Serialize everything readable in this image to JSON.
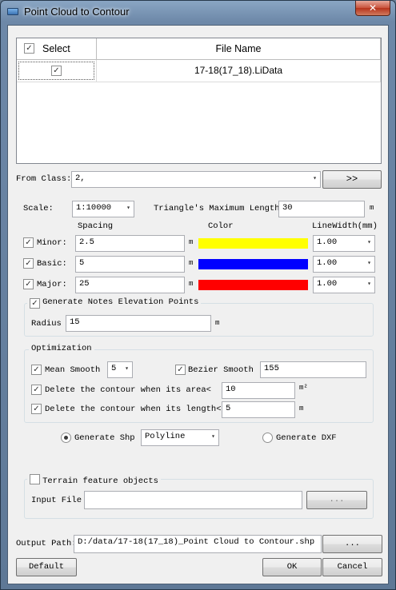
{
  "window": {
    "title": "Point Cloud to Contour",
    "close_glyph": "✕"
  },
  "file_table": {
    "columns": [
      "Select",
      "File Name"
    ],
    "rows": [
      {
        "selected": true,
        "file_name": "17-18(17_18).LiData"
      }
    ]
  },
  "from_class": {
    "label": "From Class:",
    "value": "2,",
    "button_label": ">>"
  },
  "scale": {
    "label": "Scale:",
    "value": "1:10000"
  },
  "triangle": {
    "label": "Triangle's Maximum Length",
    "value": "30",
    "unit": "m"
  },
  "contour_headers": {
    "spacing": "Spacing",
    "color": "Color",
    "linewidth": "LineWidth(mm)"
  },
  "contours": [
    {
      "label": "Minor:",
      "checked": true,
      "spacing": "2.5",
      "unit": "m",
      "color": "#ffff00",
      "linewidth": "1.00"
    },
    {
      "label": "Basic:",
      "checked": true,
      "spacing": "5",
      "unit": "m",
      "color": "#0000ff",
      "linewidth": "1.00"
    },
    {
      "label": "Major:",
      "checked": true,
      "spacing": "25",
      "unit": "m",
      "color": "#ff0000",
      "linewidth": "1.00"
    }
  ],
  "notes": {
    "label": "Generate Notes Elevation Points",
    "checked": true,
    "radius_label": "Radius",
    "radius_value": "15",
    "radius_unit": "m"
  },
  "optimization": {
    "title": "Optimization",
    "mean_smooth_label": "Mean Smooth",
    "mean_smooth_checked": true,
    "mean_smooth_value": "5",
    "bezier_label": "Bezier Smooth",
    "bezier_checked": true,
    "bezier_value": "155",
    "area_label": "Delete the contour when its area<",
    "area_checked": true,
    "area_value": "10",
    "area_unit": "m²",
    "length_label": "Delete the contour when its length<",
    "length_checked": true,
    "length_value": "5",
    "length_unit": "m"
  },
  "output_type": {
    "shp_label": "Generate Shp",
    "shp_selected": true,
    "shp_type": "Polyline",
    "dxf_label": "Generate DXF",
    "dxf_selected": false
  },
  "terrain": {
    "label": "Terrain feature objects",
    "checked": false,
    "input_label": "Input File",
    "input_value": "",
    "browse_label": "..."
  },
  "output_path": {
    "label": "Output Path:",
    "value": "D:/data/17-18(17_18)_Point Cloud to Contour.shp",
    "browse_label": "..."
  },
  "buttons": {
    "default": "Default",
    "ok": "OK",
    "cancel": "Cancel"
  },
  "glyphs": {
    "check": "✓",
    "dropdown": "▾"
  }
}
